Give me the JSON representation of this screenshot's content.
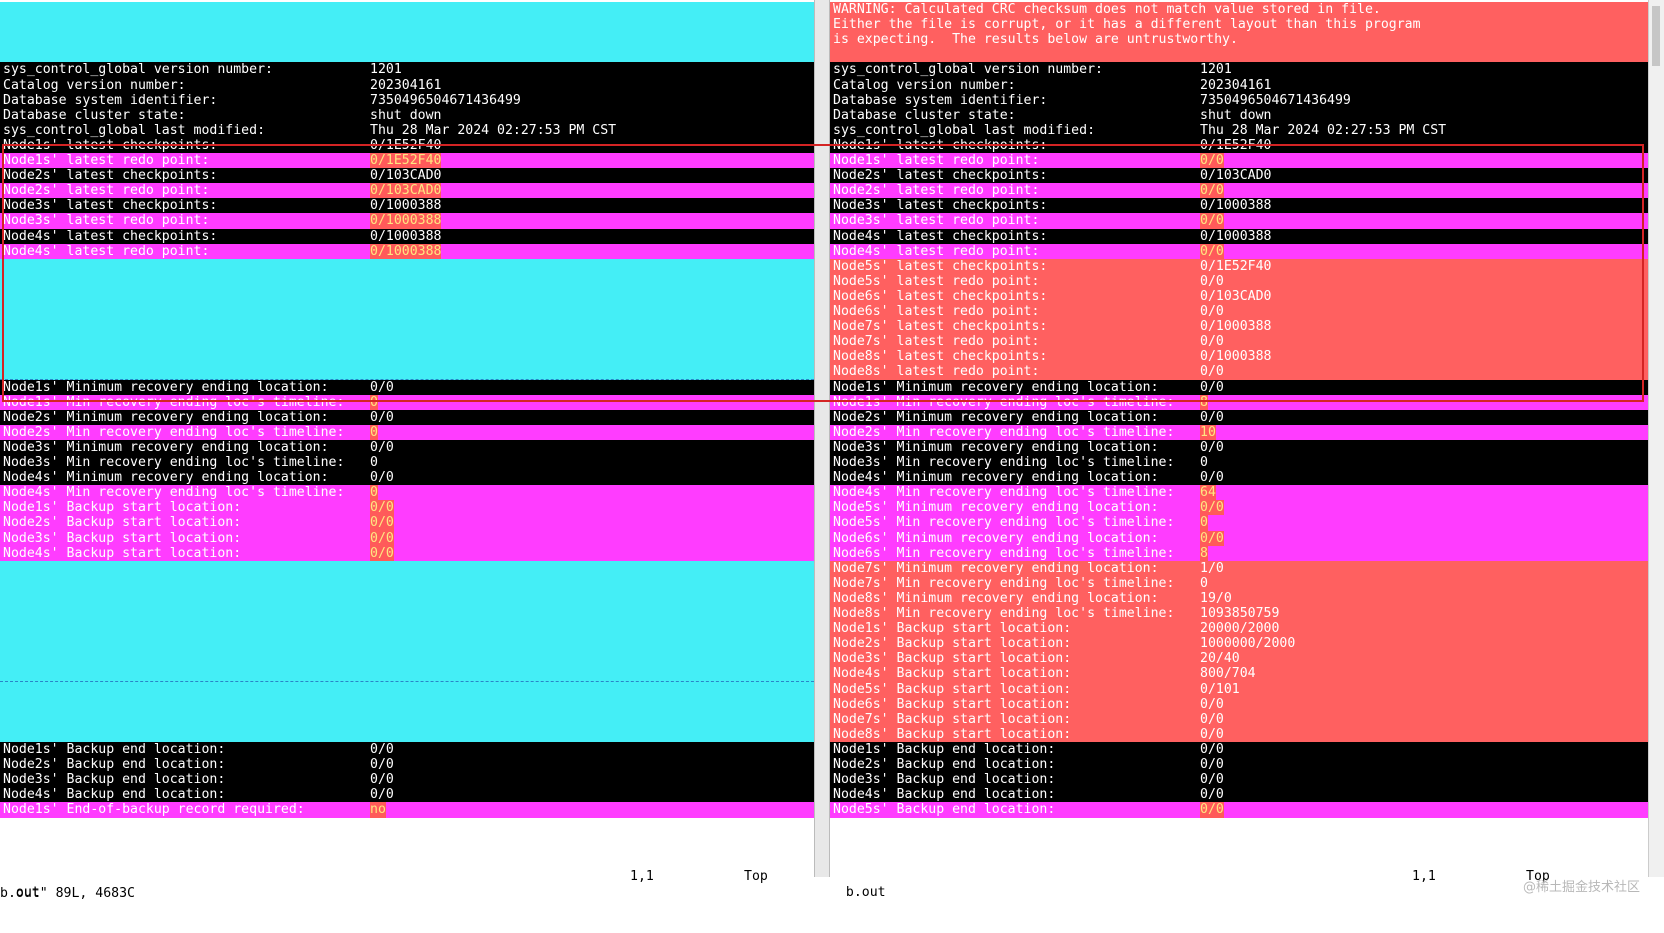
{
  "left": {
    "file": "out",
    "rows": [
      {
        "style": "cyan",
        "label": "",
        "value": ""
      },
      {
        "style": "cyan",
        "label": "",
        "value": ""
      },
      {
        "style": "cyan",
        "label": "",
        "value": ""
      },
      {
        "style": "cyan",
        "label": "",
        "value": ""
      },
      {
        "style": "black",
        "label": "sys_control_global version number:",
        "value": "1201"
      },
      {
        "style": "black",
        "label": "Catalog version number:",
        "value": "202304161"
      },
      {
        "style": "black",
        "label": "Database system identifier:",
        "value": "7350496504671436499"
      },
      {
        "style": "black",
        "label": "Database cluster state:",
        "value": "shut down"
      },
      {
        "style": "black",
        "label": "sys_control_global last modified:",
        "value": "Thu 28 Mar 2024 02:27:53 PM CST"
      },
      {
        "style": "black",
        "label": "Node1s' latest checkpoints:",
        "value": "0/1E52F40"
      },
      {
        "style": "magenta",
        "label": "Node1s' latest redo point:",
        "value": "0/1E52F40",
        "hl": true
      },
      {
        "style": "black",
        "label": "Node2s' latest checkpoints:",
        "value": "0/103CAD0"
      },
      {
        "style": "magenta",
        "label": "Node2s' latest redo point:",
        "value": "0/103CAD0",
        "hl": true
      },
      {
        "style": "black",
        "label": "Node3s' latest checkpoints:",
        "value": "0/1000388"
      },
      {
        "style": "magenta",
        "label": "Node3s' latest redo point:",
        "value": "0/1000388",
        "hl": true
      },
      {
        "style": "black",
        "label": "Node4s' latest checkpoints:",
        "value": "0/1000388"
      },
      {
        "style": "magenta",
        "label": "Node4s' latest redo point:",
        "value": "0/1000388",
        "hl": true
      },
      {
        "style": "cyan",
        "label": "",
        "value": ""
      },
      {
        "style": "cyan",
        "label": "",
        "value": ""
      },
      {
        "style": "cyan",
        "label": "",
        "value": ""
      },
      {
        "style": "cyan",
        "label": "",
        "value": ""
      },
      {
        "style": "cyan",
        "label": "",
        "value": ""
      },
      {
        "style": "cyan",
        "label": "",
        "value": ""
      },
      {
        "style": "cyan",
        "label": "",
        "value": ""
      },
      {
        "style": "cyan",
        "label": "",
        "value": ""
      },
      {
        "style": "black",
        "label": "Node1s' Minimum recovery ending location:",
        "value": "0/0"
      },
      {
        "style": "magenta",
        "label": "Node1s' Min recovery ending loc's timeline:",
        "value": "0",
        "hl": true
      },
      {
        "style": "black",
        "label": "Node2s' Minimum recovery ending location:",
        "value": "0/0"
      },
      {
        "style": "magenta",
        "label": "Node2s' Min recovery ending loc's timeline:",
        "value": "0",
        "hl": true
      },
      {
        "style": "black",
        "label": "Node3s' Minimum recovery ending location:",
        "value": "0/0"
      },
      {
        "style": "black",
        "label": "Node3s' Min recovery ending loc's timeline:",
        "value": "0"
      },
      {
        "style": "black",
        "label": "Node4s' Minimum recovery ending location:",
        "value": "0/0"
      },
      {
        "style": "magenta",
        "label": "Node4s' Min recovery ending loc's timeline:",
        "value": "0",
        "hl": true
      },
      {
        "style": "magenta",
        "label": "Node1s' Backup start location:",
        "value": "0/0",
        "hl": true
      },
      {
        "style": "magenta",
        "label": "Node2s' Backup start location:",
        "value": "0/0",
        "hl": true
      },
      {
        "style": "magenta",
        "label": "Node3s' Backup start location:",
        "value": "0/0",
        "hl": true
      },
      {
        "style": "magenta",
        "label": "Node4s' Backup start location:",
        "value": "0/0",
        "hl": true
      },
      {
        "style": "cyan",
        "label": "",
        "value": ""
      },
      {
        "style": "cyan",
        "label": "",
        "value": ""
      },
      {
        "style": "cyan",
        "label": "",
        "value": ""
      },
      {
        "style": "cyan",
        "label": "",
        "value": ""
      },
      {
        "style": "cyan",
        "label": "",
        "value": ""
      },
      {
        "style": "cyan",
        "label": "",
        "value": ""
      },
      {
        "style": "cyan",
        "label": "",
        "value": ""
      },
      {
        "style": "cyan",
        "label": "",
        "value": ""
      },
      {
        "style": "cyan",
        "label": "",
        "value": ""
      },
      {
        "style": "cyan",
        "label": "",
        "value": ""
      },
      {
        "style": "cyan",
        "label": "",
        "value": ""
      },
      {
        "style": "cyan",
        "label": "",
        "value": ""
      },
      {
        "style": "black",
        "label": "Node1s' Backup end location:",
        "value": "0/0"
      },
      {
        "style": "black",
        "label": "Node2s' Backup end location:",
        "value": "0/0"
      },
      {
        "style": "black",
        "label": "Node3s' Backup end location:",
        "value": "0/0"
      },
      {
        "style": "black",
        "label": "Node4s' Backup end location:",
        "value": "0/0"
      },
      {
        "style": "magenta",
        "label": "Node1s' End-of-backup record required:",
        "value": "no",
        "hl": true
      }
    ],
    "status_name": "out",
    "status_pos": "1,1",
    "status_scroll": "Top"
  },
  "right": {
    "file": "b.out",
    "rows": [
      {
        "style": "red",
        "label": "WARNING: Calculated CRC checksum does not match value stored in file.",
        "value": ""
      },
      {
        "style": "red",
        "label": "Either the file is corrupt, or it has a different layout than this program",
        "value": ""
      },
      {
        "style": "red",
        "label": "is expecting.  The results below are untrustworthy.",
        "value": ""
      },
      {
        "style": "red",
        "label": "",
        "value": ""
      },
      {
        "style": "black",
        "label": "sys_control_global version number:",
        "value": "1201"
      },
      {
        "style": "black",
        "label": "Catalog version number:",
        "value": "202304161"
      },
      {
        "style": "black",
        "label": "Database system identifier:",
        "value": "7350496504671436499"
      },
      {
        "style": "black",
        "label": "Database cluster state:",
        "value": "shut down"
      },
      {
        "style": "black",
        "label": "sys_control_global last modified:",
        "value": "Thu 28 Mar 2024 02:27:53 PM CST"
      },
      {
        "style": "black",
        "label": "Node1s' latest checkpoints:",
        "value": "0/1E52F40"
      },
      {
        "style": "magenta",
        "label": "Node1s' latest redo point:",
        "value": "0/0",
        "hl": true
      },
      {
        "style": "black",
        "label": "Node2s' latest checkpoints:",
        "value": "0/103CAD0"
      },
      {
        "style": "magenta",
        "label": "Node2s' latest redo point:",
        "value": "0/0",
        "hl": true
      },
      {
        "style": "black",
        "label": "Node3s' latest checkpoints:",
        "value": "0/1000388"
      },
      {
        "style": "magenta",
        "label": "Node3s' latest redo point:",
        "value": "0/0",
        "hl": true
      },
      {
        "style": "black",
        "label": "Node4s' latest checkpoints:",
        "value": "0/1000388"
      },
      {
        "style": "magenta",
        "label": "Node4s' latest redo point:",
        "value": "0/0",
        "hl": true
      },
      {
        "style": "red",
        "label": "Node5s' latest checkpoints:",
        "value": "0/1E52F40"
      },
      {
        "style": "red",
        "label": "Node5s' latest redo point:",
        "value": "0/0"
      },
      {
        "style": "red",
        "label": "Node6s' latest checkpoints:",
        "value": "0/103CAD0"
      },
      {
        "style": "red",
        "label": "Node6s' latest redo point:",
        "value": "0/0"
      },
      {
        "style": "red",
        "label": "Node7s' latest checkpoints:",
        "value": "0/1000388"
      },
      {
        "style": "red",
        "label": "Node7s' latest redo point:",
        "value": "0/0"
      },
      {
        "style": "red",
        "label": "Node8s' latest checkpoints:",
        "value": "0/1000388"
      },
      {
        "style": "red",
        "label": "Node8s' latest redo point:",
        "value": "0/0"
      },
      {
        "style": "black",
        "label": "Node1s' Minimum recovery ending location:",
        "value": "0/0"
      },
      {
        "style": "magenta",
        "label": "Node1s' Min recovery ending loc's timeline:",
        "value": "8",
        "hl": true
      },
      {
        "style": "black",
        "label": "Node2s' Minimum recovery ending location:",
        "value": "0/0"
      },
      {
        "style": "magenta",
        "label": "Node2s' Min recovery ending loc's timeline:",
        "value": "10",
        "hl": true
      },
      {
        "style": "black",
        "label": "Node3s' Minimum recovery ending location:",
        "value": "0/0"
      },
      {
        "style": "black",
        "label": "Node3s' Min recovery ending loc's timeline:",
        "value": "0"
      },
      {
        "style": "black",
        "label": "Node4s' Minimum recovery ending location:",
        "value": "0/0"
      },
      {
        "style": "magenta",
        "label": "Node4s' Min recovery ending loc's timeline:",
        "value": "64",
        "hl": true
      },
      {
        "style": "magenta",
        "label": "Node5s' Minimum recovery ending location:",
        "value": "0/0",
        "hl": true
      },
      {
        "style": "magenta",
        "label": "Node5s' Min recovery ending loc's timeline:",
        "value": "0",
        "hl": true
      },
      {
        "style": "magenta",
        "label": "Node6s' Minimum recovery ending location:",
        "value": "0/0",
        "hl": true
      },
      {
        "style": "magenta",
        "label": "Node6s' Min recovery ending loc's timeline:",
        "value": "8",
        "hl": true
      },
      {
        "style": "red",
        "label": "Node7s' Minimum recovery ending location:",
        "value": "1/0"
      },
      {
        "style": "red",
        "label": "Node7s' Min recovery ending loc's timeline:",
        "value": "0"
      },
      {
        "style": "red",
        "label": "Node8s' Minimum recovery ending location:",
        "value": "19/0"
      },
      {
        "style": "red",
        "label": "Node8s' Min recovery ending loc's timeline:",
        "value": "1093850759"
      },
      {
        "style": "red",
        "label": "Node1s' Backup start location:",
        "value": "20000/2000"
      },
      {
        "style": "red",
        "label": "Node2s' Backup start location:",
        "value": "1000000/2000"
      },
      {
        "style": "red",
        "label": "Node3s' Backup start location:",
        "value": "20/40"
      },
      {
        "style": "red",
        "label": "Node4s' Backup start location:",
        "value": "800/704"
      },
      {
        "style": "red",
        "label": "Node5s' Backup start location:",
        "value": "0/101"
      },
      {
        "style": "red",
        "label": "Node6s' Backup start location:",
        "value": "0/0"
      },
      {
        "style": "red",
        "label": "Node7s' Backup start location:",
        "value": "0/0"
      },
      {
        "style": "red",
        "label": "Node8s' Backup start location:",
        "value": "0/0"
      },
      {
        "style": "black",
        "label": "Node1s' Backup end location:",
        "value": "0/0"
      },
      {
        "style": "black",
        "label": "Node2s' Backup end location:",
        "value": "0/0"
      },
      {
        "style": "black",
        "label": "Node3s' Backup end location:",
        "value": "0/0"
      },
      {
        "style": "black",
        "label": "Node4s' Backup end location:",
        "value": "0/0"
      },
      {
        "style": "magenta",
        "label": "Node5s' Backup end location:",
        "value": "0/0",
        "hl": true
      }
    ],
    "status_name": "b.out",
    "status_pos": "1,1",
    "status_scroll": "Top"
  },
  "cmdline": "b.out\" 89L, 4683C",
  "watermark": "@稀土掘金技术社区",
  "colors": {
    "black": "#000000",
    "magenta": "#ff3cff",
    "red": "#ff6060",
    "cyan": "#44eef6",
    "highlight_box": "#d42424"
  }
}
